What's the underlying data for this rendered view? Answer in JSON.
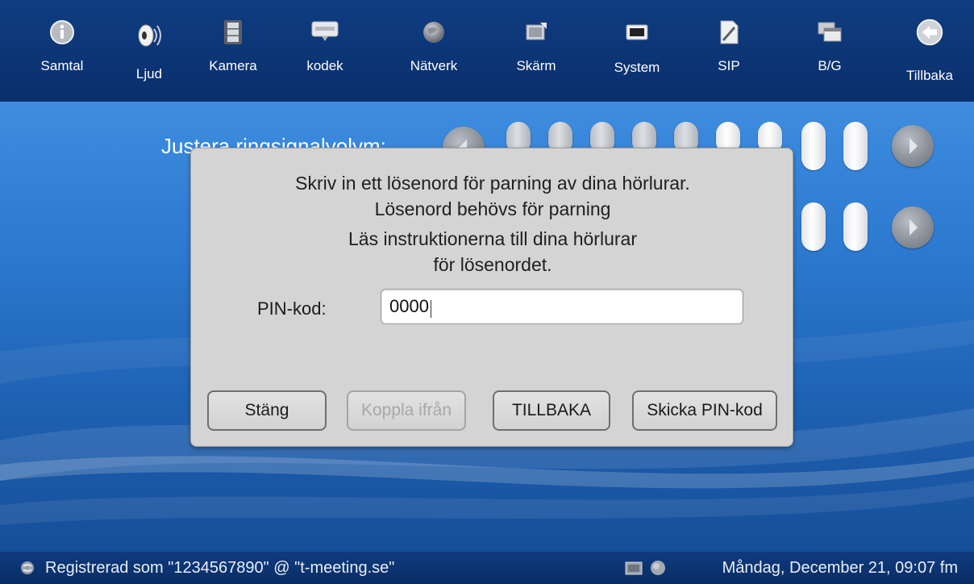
{
  "toolbar": {
    "items": [
      {
        "label": "Samtal",
        "icon": "info-icon"
      },
      {
        "label": "Ljud",
        "icon": "speaker-icon"
      },
      {
        "label": "Kamera",
        "icon": "film-icon"
      },
      {
        "label": "kodek",
        "icon": "codec-icon"
      },
      {
        "label": "Nätverk",
        "icon": "globe-icon"
      },
      {
        "label": "Skärm",
        "icon": "screen-icon"
      },
      {
        "label": "System",
        "icon": "system-icon"
      },
      {
        "label": "SIP",
        "icon": "document-icon"
      },
      {
        "label": "B/G",
        "icon": "windows-icon"
      },
      {
        "label": "Tillbaka",
        "icon": "back-arrow-icon"
      }
    ]
  },
  "background_screen": {
    "volume_label": "Justera ringsignalvolym:"
  },
  "dialog": {
    "lines": [
      "Skriv in ett lösenord för parning av dina hörlurar.",
      "Lösenord behövs för parning",
      "Läs instruktionerna till dina hörlurar",
      "för lösenordet."
    ],
    "pin_label": "PIN-kod:",
    "pin_value": "0000",
    "buttons": {
      "close": "Stäng",
      "disconnect": "Koppla ifrån",
      "back": "TILLBAKA",
      "send_pin": "Skicka PIN-kod"
    }
  },
  "status": {
    "registration": "Registrerad som \"1234567890\" @ \"t-meeting.se\"",
    "datetime": "Måndag, December 21, 09:07 fm"
  },
  "colors": {
    "toolbar_bg": "#0a2f6b",
    "background": "#2b78cf",
    "dialog_bg": "#d4d4d4"
  }
}
